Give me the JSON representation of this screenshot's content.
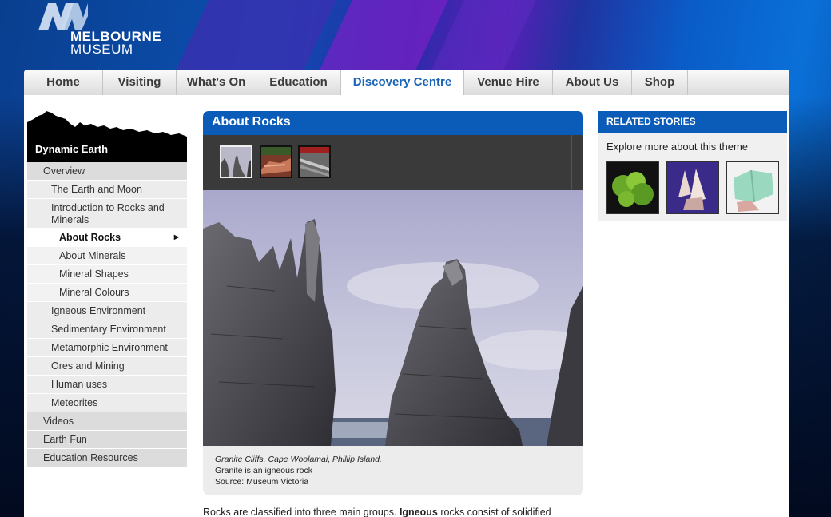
{
  "logo": {
    "line1": "MELBOURNE",
    "line2": "MUSEUM"
  },
  "nav": {
    "items": [
      {
        "label": "Home"
      },
      {
        "label": "Visiting"
      },
      {
        "label": "What's On"
      },
      {
        "label": "Education"
      },
      {
        "label": "Discovery Centre"
      },
      {
        "label": "Venue Hire"
      },
      {
        "label": "About Us"
      },
      {
        "label": "Shop"
      }
    ]
  },
  "sidebar": {
    "title": "Dynamic Earth",
    "items": [
      {
        "label": "Overview"
      },
      {
        "label": "The Earth and Moon"
      },
      {
        "label": "Introduction to Rocks and"
      },
      {
        "label": "Minerals"
      },
      {
        "label": "About Rocks",
        "arrow": "▶"
      },
      {
        "label": "About Minerals"
      },
      {
        "label": "Mineral Shapes"
      },
      {
        "label": "Mineral Colours"
      },
      {
        "label": "Igneous Environment"
      },
      {
        "label": "Sedimentary Environment"
      },
      {
        "label": "Metamorphic Environment"
      },
      {
        "label": "Ores and Mining"
      },
      {
        "label": "Human uses"
      },
      {
        "label": "Meteorites"
      },
      {
        "label": "Videos"
      },
      {
        "label": "Earth Fun"
      },
      {
        "label": "Education Resources"
      }
    ]
  },
  "main": {
    "title": "About Rocks",
    "caption": {
      "line1": "Granite Cliffs, Cape Woolamai, Phillip Island.",
      "line2": "Granite is an igneous rock",
      "line3": "Source: Museum Victoria"
    },
    "body": {
      "pre": "Rocks are classified into three main groups. ",
      "bold": "Igneous",
      "post": " rocks consist of solidified"
    }
  },
  "related": {
    "title_bold": "RELATED",
    "title_rest": " STORIES",
    "text": "Explore more about this theme"
  },
  "colors": {
    "accent": "#0a5cb8",
    "nav_active": "#1a64b8"
  }
}
